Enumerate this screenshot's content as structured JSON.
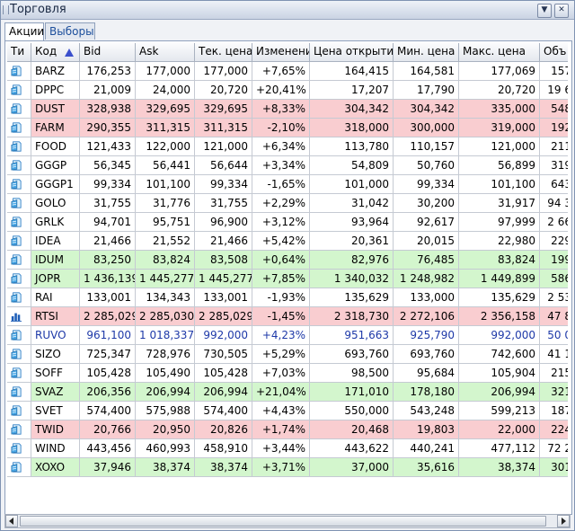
{
  "window": {
    "title": "Торговля"
  },
  "tabs": [
    {
      "label": "Акции",
      "active": true
    },
    {
      "label": "Выборы",
      "active": false
    }
  ],
  "columns": [
    "Ти",
    "Код",
    "Bid",
    "Ask",
    "Тек. цена",
    "Изменени",
    "Цена открытия",
    "Мин. цена",
    "Макс. цена",
    "Объ"
  ],
  "rows": [
    {
      "type": "doc",
      "status": "white",
      "cells": [
        "BARZ",
        "176,253",
        "177,000",
        "177,000",
        "+7,65%",
        "164,415",
        "164,581",
        "177,069",
        "157"
      ]
    },
    {
      "type": "doc",
      "status": "white",
      "cells": [
        "DPPC",
        "21,009",
        "24,000",
        "20,720",
        "+20,41%",
        "17,207",
        "17,790",
        "20,720",
        "19 6"
      ]
    },
    {
      "type": "doc",
      "status": "red",
      "cells": [
        "DUST",
        "328,938",
        "329,695",
        "329,695",
        "+8,33%",
        "304,342",
        "304,342",
        "335,000",
        "548"
      ]
    },
    {
      "type": "doc",
      "status": "red",
      "cells": [
        "FARM",
        "290,355",
        "311,315",
        "311,315",
        "-2,10%",
        "318,000",
        "300,000",
        "319,000",
        "192"
      ]
    },
    {
      "type": "doc",
      "status": "white",
      "cells": [
        "FOOD",
        "121,433",
        "122,000",
        "121,000",
        "+6,34%",
        "113,780",
        "110,157",
        "121,000",
        "211"
      ]
    },
    {
      "type": "doc",
      "status": "white",
      "cells": [
        "GGGP",
        "56,345",
        "56,441",
        "56,644",
        "+3,34%",
        "54,809",
        "50,760",
        "56,899",
        "319"
      ]
    },
    {
      "type": "doc",
      "status": "white",
      "cells": [
        "GGGP1",
        "99,334",
        "101,100",
        "99,334",
        "-1,65%",
        "101,000",
        "99,334",
        "101,100",
        "643"
      ]
    },
    {
      "type": "doc",
      "status": "white",
      "cells": [
        "GOLO",
        "31,755",
        "31,776",
        "31,755",
        "+2,29%",
        "31,042",
        "30,200",
        "31,917",
        "94 3"
      ]
    },
    {
      "type": "doc",
      "status": "white",
      "cells": [
        "GRLK",
        "94,701",
        "95,751",
        "96,900",
        "+3,12%",
        "93,964",
        "92,617",
        "97,999",
        "2 66"
      ]
    },
    {
      "type": "doc",
      "status": "white",
      "cells": [
        "IDEA",
        "21,466",
        "21,552",
        "21,466",
        "+5,42%",
        "20,361",
        "20,015",
        "22,980",
        "229"
      ]
    },
    {
      "type": "doc",
      "status": "green",
      "cells": [
        "IDUM",
        "83,250",
        "83,824",
        "83,508",
        "+0,64%",
        "82,976",
        "76,485",
        "83,824",
        "199"
      ]
    },
    {
      "type": "doc",
      "status": "green",
      "cells": [
        "JOPR",
        "1 436,139",
        "1 445,277",
        "1 445,277",
        "+7,85%",
        "1 340,032",
        "1 248,982",
        "1 449,899",
        "586"
      ]
    },
    {
      "type": "doc",
      "status": "white",
      "cells": [
        "RAI",
        "133,001",
        "134,343",
        "133,001",
        "-1,93%",
        "135,629",
        "133,000",
        "135,629",
        "2 53"
      ]
    },
    {
      "type": "chart",
      "status": "red",
      "cells": [
        "RTSI",
        "2 285,029",
        "2 285,030",
        "2 285,029",
        "-1,45%",
        "2 318,730",
        "2 272,106",
        "2 356,158",
        "47 8"
      ]
    },
    {
      "type": "doc",
      "status": "blue",
      "cells": [
        "RUVO",
        "961,100",
        "1 018,337",
        "992,000",
        "+4,23%",
        "951,663",
        "925,790",
        "992,000",
        "50 0"
      ]
    },
    {
      "type": "doc",
      "status": "white",
      "cells": [
        "SIZO",
        "725,347",
        "728,976",
        "730,505",
        "+5,29%",
        "693,760",
        "693,760",
        "742,600",
        "41 1"
      ]
    },
    {
      "type": "doc",
      "status": "white",
      "cells": [
        "SOFF",
        "105,428",
        "105,490",
        "105,428",
        "+7,03%",
        "98,500",
        "95,684",
        "105,904",
        "215"
      ]
    },
    {
      "type": "doc",
      "status": "green",
      "cells": [
        "SVAZ",
        "206,356",
        "206,994",
        "206,994",
        "+21,04%",
        "171,010",
        "178,180",
        "206,994",
        "321"
      ]
    },
    {
      "type": "doc",
      "status": "white",
      "cells": [
        "SVET",
        "574,400",
        "575,988",
        "574,400",
        "+4,43%",
        "550,000",
        "543,248",
        "599,213",
        "187"
      ]
    },
    {
      "type": "doc",
      "status": "red",
      "cells": [
        "TWID",
        "20,766",
        "20,950",
        "20,826",
        "+1,74%",
        "20,468",
        "19,803",
        "22,000",
        "224"
      ]
    },
    {
      "type": "doc",
      "status": "white",
      "cells": [
        "WIND",
        "443,456",
        "460,993",
        "458,910",
        "+3,44%",
        "443,622",
        "440,241",
        "477,112",
        "72 2"
      ]
    },
    {
      "type": "doc",
      "status": "green",
      "cells": [
        "XOXO",
        "37,946",
        "38,374",
        "38,374",
        "+3,71%",
        "37,000",
        "35,616",
        "38,374",
        "301"
      ]
    }
  ],
  "colors": {
    "up_row": "#d3f6cd",
    "down_row": "#f9cdd0",
    "blue_text": "#1e39a8",
    "sort_arrow": "#3a4fcc"
  }
}
